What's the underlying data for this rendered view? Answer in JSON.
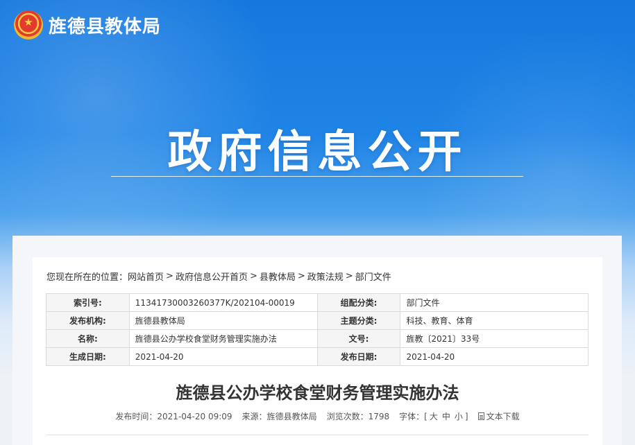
{
  "header": {
    "site_title": "旌德县教体局",
    "emblem_icon": "national-emblem-icon"
  },
  "hero": {
    "title": "政府信息公开"
  },
  "breadcrumb": {
    "prefix": "您现在所在的位置：",
    "items": [
      "网站首页",
      "政府信息公开首页",
      "县教体局",
      "政策法规",
      "部门文件"
    ]
  },
  "info": {
    "rows": [
      {
        "l1": "索引号:",
        "v1": "11341730003260377K/202104-00019",
        "l2": "组配分类:",
        "v2": "部门文件"
      },
      {
        "l1": "发布机构:",
        "v1": "旌德县教体局",
        "l2": "主题分类:",
        "v2": "科技、教育、体育"
      },
      {
        "l1": "名称:",
        "v1": "旌德县公办学校食堂财务管理实施办法",
        "l2": "文号:",
        "v2": "旌教〔2021〕33号"
      },
      {
        "l1": "生成日期:",
        "v1": "2021-04-20",
        "l2": "发布日期:",
        "v2": "2021-04-20"
      }
    ]
  },
  "doc": {
    "title": "旌德县公办学校食堂财务管理实施办法",
    "publish_time_label": "发布时间：",
    "publish_time": "2021-04-20 09:09",
    "source_label": "来源：",
    "source": "旌德县教体局",
    "views_label": "浏览次数：",
    "views": "1798",
    "font_label": "字体：",
    "font_open": "[",
    "font_large": "大",
    "font_medium": "中",
    "font_small": "小",
    "font_close": "]",
    "download_label": "文本下载",
    "download_icon": "document-icon"
  }
}
